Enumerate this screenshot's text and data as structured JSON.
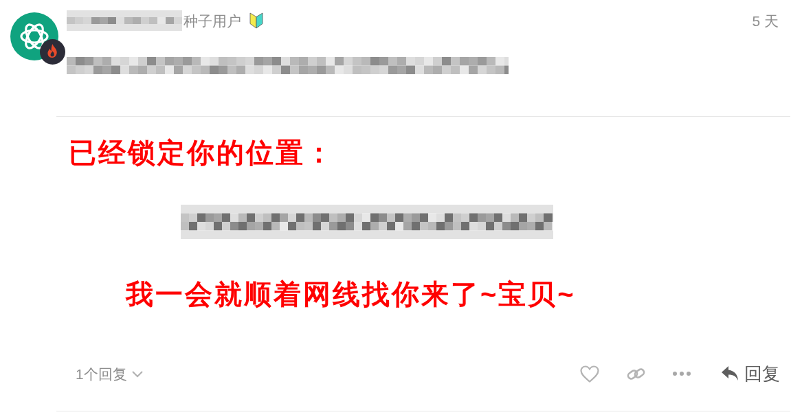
{
  "post": {
    "user_title": "种子用户",
    "time": "5 天",
    "image": {
      "heading": "已经锁定你的位置：",
      "message": "我一会就顺着网线找你来了~宝贝~"
    },
    "replies": {
      "label": "1个回复",
      "expanded": false
    },
    "liked": false,
    "reply_button": "回复"
  }
}
